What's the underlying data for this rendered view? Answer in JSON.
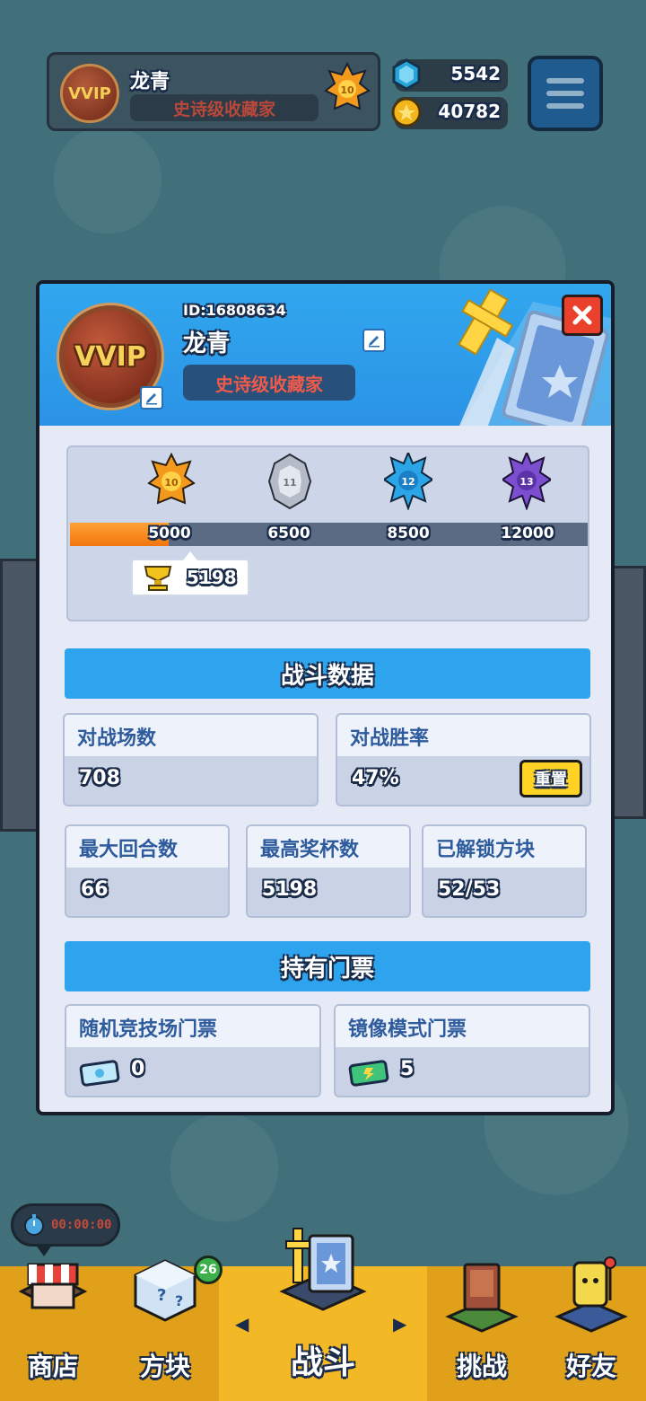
{
  "hud": {
    "player_name": "龙青",
    "player_title": "史诗级收藏家",
    "avatar_text": "VVIP",
    "rank_level": "10",
    "gems": "5542",
    "coins": "40782"
  },
  "profile": {
    "id_label": "ID:16808634",
    "name": "龙青",
    "title": "史诗级收藏家",
    "avatar_text": "VVIP"
  },
  "trophy_road": {
    "current_trophies": "5198",
    "progress_fraction": 0.19,
    "ranks": [
      {
        "level": "10",
        "threshold": "5000",
        "color": "#f39a1d"
      },
      {
        "level": "11",
        "threshold": "6500",
        "color": "#b5bcc8"
      },
      {
        "level": "12",
        "threshold": "8500",
        "color": "#2aa6e8"
      },
      {
        "level": "13",
        "threshold": "12000",
        "color": "#7b4fd0"
      }
    ]
  },
  "battle_stats": {
    "section_title": "战斗数据",
    "matches_label": "对战场数",
    "matches_value": "708",
    "winrate_label": "对战胜率",
    "winrate_value": "47%",
    "reset_label": "重置",
    "max_rounds_label": "最大回合数",
    "max_rounds_value": "66",
    "max_trophies_label": "最高奖杯数",
    "max_trophies_value": "5198",
    "unlocked_label": "已解锁方块",
    "unlocked_value": "52/53"
  },
  "tickets": {
    "section_title": "持有门票",
    "arena_label": "随机竞技场门票",
    "arena_value": "0",
    "mirror_label": "镜像模式门票",
    "mirror_value": "5"
  },
  "timer": "00:00:00",
  "nav": {
    "shop": "商店",
    "blocks": "方块",
    "blocks_badge": "26",
    "battle": "战斗",
    "challenge": "挑战",
    "friends": "好友"
  }
}
